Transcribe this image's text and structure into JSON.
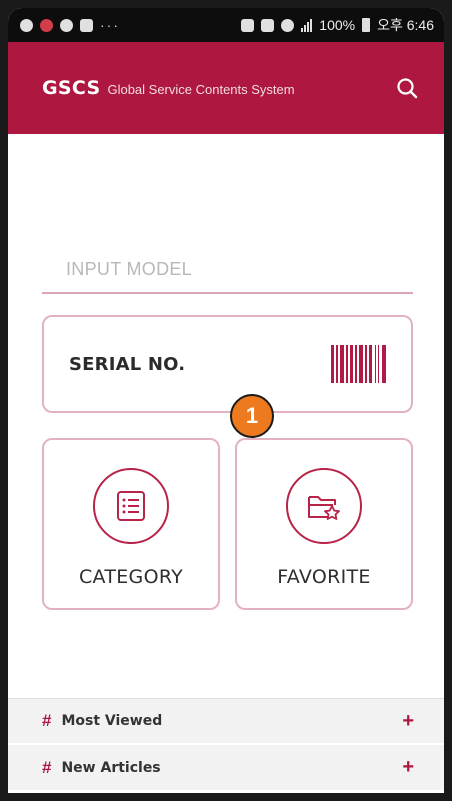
{
  "status_bar": {
    "dots": "···",
    "battery": "100%",
    "time": "오후 6:46"
  },
  "header": {
    "brand": "GSCS",
    "subtitle": "Global Service Contents System",
    "search_icon": "search-icon"
  },
  "model_input": {
    "placeholder": "INPUT MODEL",
    "value": ""
  },
  "serial_card": {
    "label": "SERIAL NO.",
    "icon": "barcode-icon"
  },
  "tiles": [
    {
      "label": "CATEGORY",
      "icon": "list-document-icon"
    },
    {
      "label": "FAVORITE",
      "icon": "star-folder-icon"
    }
  ],
  "annotation_badge": "1",
  "links": [
    {
      "label": "Most Viewed",
      "prefix": "#",
      "action": "+"
    },
    {
      "label": "New Articles",
      "prefix": "#",
      "action": "+"
    }
  ],
  "colors": {
    "brand": "#ad1740",
    "card_border": "#e2b3be",
    "badge": "#ee7a1f"
  }
}
